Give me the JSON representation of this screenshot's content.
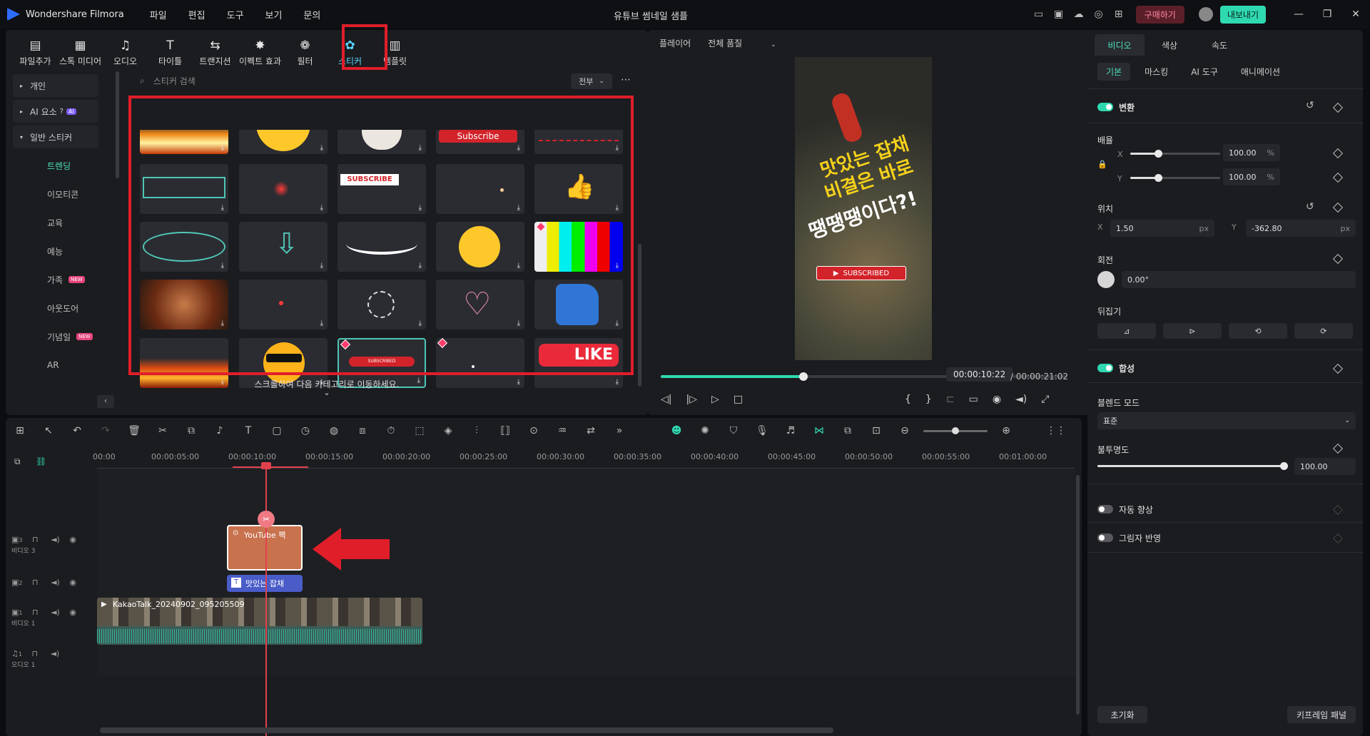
{
  "app": {
    "name": "Wondershare Filmora",
    "window_title": "유튜브 썸네일 샘플",
    "menus": [
      "파일",
      "편집",
      "도구",
      "보기",
      "문의"
    ],
    "buy_label": "구매하기",
    "export_label": "내보내기"
  },
  "media_tabs": [
    {
      "label": "파일추가",
      "icon": "import-icon"
    },
    {
      "label": "스톡 미디어",
      "icon": "stock-media-icon"
    },
    {
      "label": "오디오",
      "icon": "music-note-icon"
    },
    {
      "label": "타이틀",
      "icon": "text-T-icon"
    },
    {
      "label": "트랜지션",
      "icon": "transition-icon"
    },
    {
      "label": "이펙트 효과",
      "icon": "effects-icon"
    },
    {
      "label": "필터",
      "icon": "filter-icon"
    },
    {
      "label": "스티커",
      "icon": "sticker-icon",
      "selected": true
    },
    {
      "label": "템플릿",
      "icon": "template-icon"
    }
  ],
  "sidebar": {
    "groups": [
      "개인",
      "AI 요소",
      "일반 스티커"
    ],
    "ai_badge": "AI",
    "items": [
      {
        "label": "트렌딩",
        "active": true
      },
      {
        "label": "이모티콘"
      },
      {
        "label": "교육"
      },
      {
        "label": "예능"
      },
      {
        "label": "가족",
        "badge": "NEW"
      },
      {
        "label": "아웃도어"
      },
      {
        "label": "기념일",
        "badge": "NEW"
      },
      {
        "label": "AR"
      }
    ]
  },
  "search": {
    "placeholder": "스티커 검색",
    "filter": "전부"
  },
  "stickers": {
    "subscribe_text": "Subscribe",
    "subscribe_red": "SUBSCRIBE",
    "subscribed_text": "SUBSCRIBED",
    "like_text": "LIKE"
  },
  "scroll_hint": "스크롤하여 다음 카테고리로 이동하세요.",
  "player": {
    "label": "플레이어",
    "quality": "전체 품질",
    "overlay_line1": "맛있는 잡채",
    "overlay_line2": "비결은 바로",
    "overlay_line3": "땡땡땡이다?!",
    "overlay_button": "SUBSCRIBED",
    "current_time": "00:00:10:22",
    "total_time": "/ 00:00:21:02",
    "progress": 0.35
  },
  "properties": {
    "tabs": [
      "비디오",
      "색상",
      "속도"
    ],
    "subtabs": [
      "기본",
      "마스킹",
      "AI 도구",
      "애니메이션"
    ],
    "transform_label": "변환",
    "scale_label": "배율",
    "scale_x": "100.00",
    "scale_y": "100.00",
    "percent": "%",
    "position_label": "위치",
    "pos_x": "1.50",
    "pos_y": "-362.80",
    "px": "px",
    "axis_x": "X",
    "axis_y": "Y",
    "rotation_label": "회전",
    "rotation": "0.00°",
    "flip_label": "뒤집기",
    "composite_label": "합성",
    "blend_label": "블렌드 모드",
    "blend_value": "표준",
    "opacity_label": "불투명도",
    "opacity": "100.00",
    "auto_enhance": "자동 향상",
    "drop_shadow": "그림자 반영",
    "reset": "초기화",
    "keyframe": "키프레임 패널"
  },
  "timeline": {
    "ruler": [
      "00:00",
      "00:00:05:00",
      "00:00:10:00",
      "00:00:15:00",
      "00:00:20:00",
      "00:00:25:00",
      "00:00:30:00",
      "00:00:35:00",
      "00:00:40:00",
      "00:00:45:00",
      "00:00:50:00",
      "00:00:55:00",
      "00:01:00:00"
    ],
    "tracks": [
      {
        "num": "3",
        "name": "비디오 3"
      },
      {
        "num": "2",
        "name": ""
      },
      {
        "num": "1",
        "name": "비디오 1"
      },
      {
        "num": "1",
        "name": "오디오 1"
      }
    ],
    "clip_sticker": "YouTube 팩",
    "clip_title": "맛있는 잡채",
    "clip_video": "KakaoTalk_20240902_095205509"
  },
  "colors": {
    "accent": "#2fd9b0",
    "highlight": "#e01e2a",
    "panel": "#1b1c20"
  }
}
